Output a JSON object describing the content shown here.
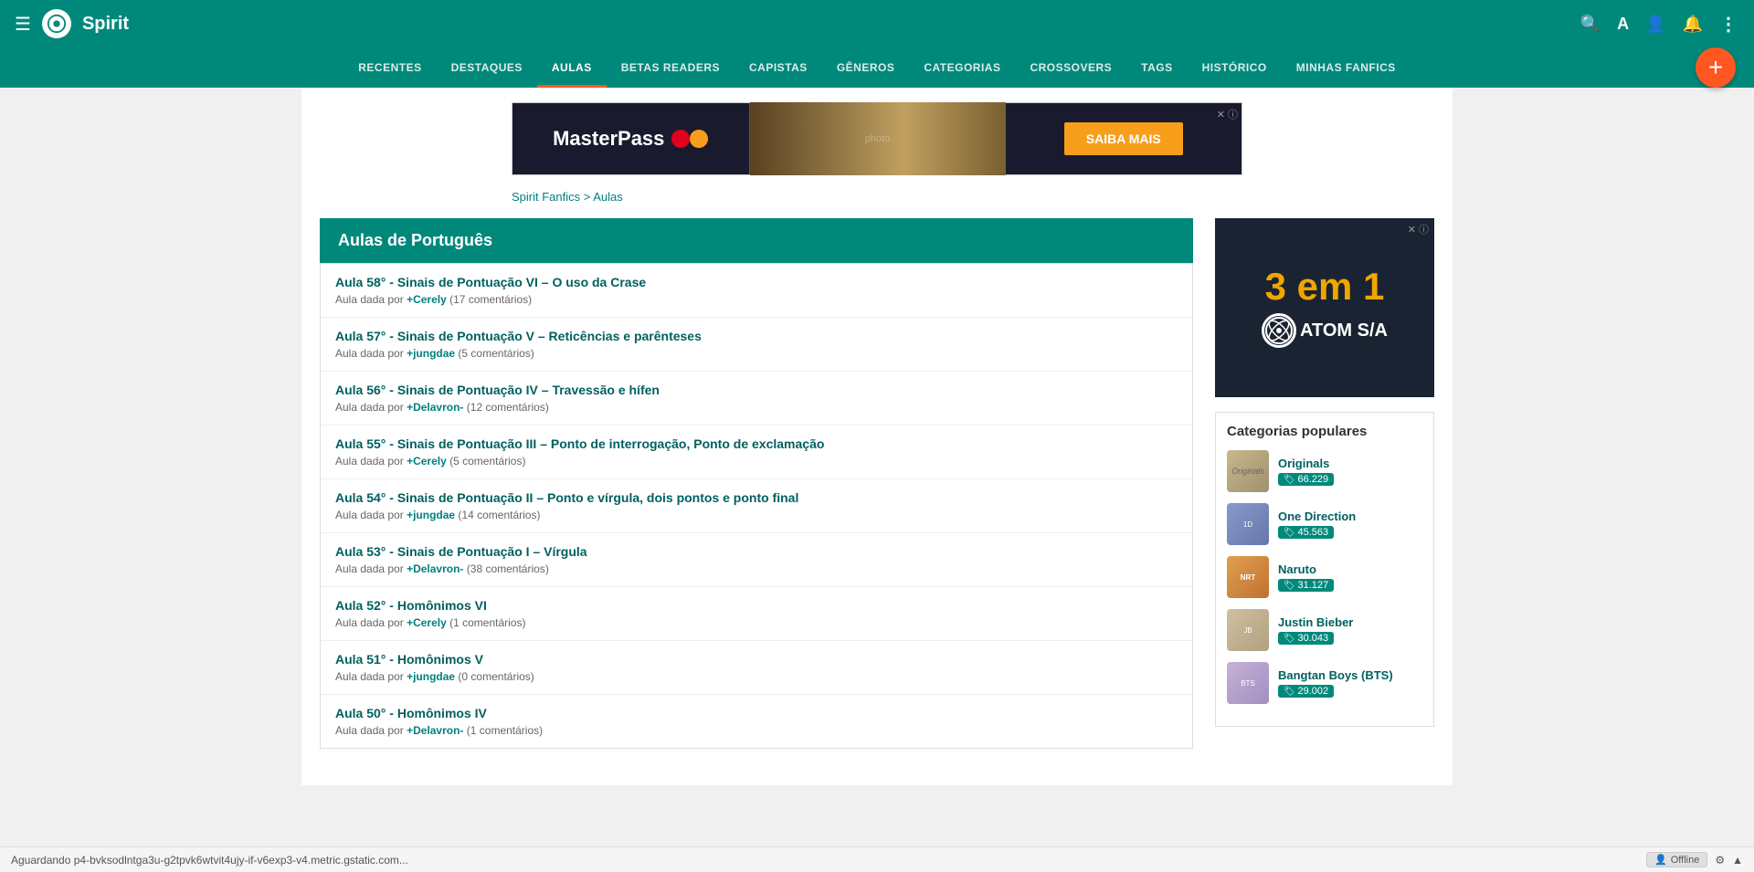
{
  "topNav": {
    "title": "Spirit",
    "menuIcon": "☰",
    "icons": [
      "🔍",
      "A",
      "👤",
      "🔔",
      "⋮"
    ]
  },
  "mainNav": {
    "items": [
      {
        "label": "RECENTES",
        "active": false
      },
      {
        "label": "DESTAQUES",
        "active": false
      },
      {
        "label": "AULAS",
        "active": true
      },
      {
        "label": "BETAS READERS",
        "active": false
      },
      {
        "label": "CAPISTAS",
        "active": false
      },
      {
        "label": "GÊNEROS",
        "active": false
      },
      {
        "label": "CATEGORIAS",
        "active": false
      },
      {
        "label": "CROSSOVERS",
        "active": false
      },
      {
        "label": "TAGS",
        "active": false
      },
      {
        "label": "HISTÓRICO",
        "active": false
      },
      {
        "label": "MINHAS FANFICS",
        "active": false
      }
    ],
    "fabLabel": "+"
  },
  "breadcrumb": {
    "home": "Spirit Fanfics",
    "separator": " > ",
    "current": "Aulas"
  },
  "section": {
    "title": "Aulas de Português"
  },
  "lessons": [
    {
      "title": "Aula 58° - Sinais de Pontuação VI – O uso da Crase",
      "teacher": "+Cerely",
      "comments": "17 comentários"
    },
    {
      "title": "Aula 57° - Sinais de Pontuação V – Reticências e parênteses",
      "teacher": "+jungdae",
      "comments": "5 comentários"
    },
    {
      "title": "Aula 56° - Sinais de Pontuação IV – Travessão e hífen",
      "teacher": "+Delavron-",
      "comments": "12 comentários"
    },
    {
      "title": "Aula 55° - Sinais de Pontuação III – Ponto de interrogação, Ponto de exclamação",
      "teacher": "+Cerely",
      "comments": "5 comentários"
    },
    {
      "title": "Aula 54° - Sinais de Pontuação II – Ponto e vírgula, dois pontos e ponto final",
      "teacher": "+jungdae",
      "comments": "14 comentários"
    },
    {
      "title": "Aula 53° - Sinais de Pontuação I – Vírgula",
      "teacher": "+Delavron-",
      "comments": "38 comentários"
    },
    {
      "title": "Aula 52° - Homônimos VI",
      "teacher": "+Cerely",
      "comments": "1 comentários"
    },
    {
      "title": "Aula 51° - Homônimos V",
      "teacher": "+jungdae",
      "comments": "0 comentários"
    },
    {
      "title": "Aula 50° - Homônimos IV",
      "teacher": "+Delavron-",
      "comments": "1 comentários"
    }
  ],
  "ad": {
    "masterpass": "MasterPass",
    "saibaMais": "SAIBA MAIS",
    "threeinone": "3 em 1",
    "atom": "ATOM S/A"
  },
  "popular": {
    "title": "Categorias populares",
    "categories": [
      {
        "name": "Originals",
        "count": "66.229",
        "thumbType": "originals"
      },
      {
        "name": "One Direction",
        "count": "45.563",
        "thumbType": "1d"
      },
      {
        "name": "Naruto",
        "count": "31.127",
        "thumbType": "naruto"
      },
      {
        "name": "Justin Bieber",
        "count": "30.043",
        "thumbType": "jb"
      },
      {
        "name": "Bangtan Boys (BTS)",
        "count": "29.002",
        "thumbType": "bts"
      }
    ]
  },
  "statusBar": {
    "url": "Aguardando p4-bvksodlntga3u-g2tpvk6wtvit4ujy-if-v6exp3-v4.metric.gstatic.com...",
    "offline": "Offline",
    "settingsIcon": "⚙",
    "chevronIcon": "▲"
  }
}
